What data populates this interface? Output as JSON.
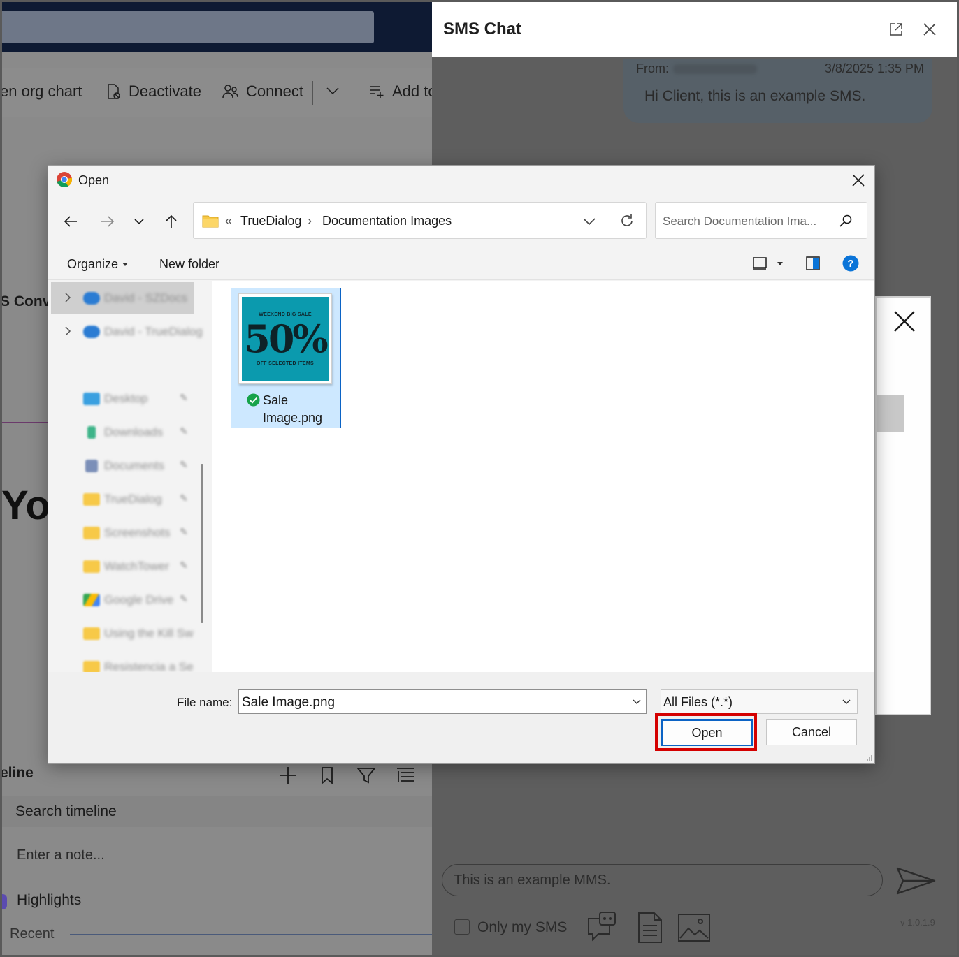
{
  "background_app": {
    "commands": {
      "org_chart": "en org chart",
      "deactivate": "Deactivate",
      "connect": "Connect",
      "add_to": "Add to"
    },
    "conversations_fragment": "S Conv",
    "heading_fragment": "Yo",
    "timeline": {
      "header": "eline",
      "search_placeholder": "Search timeline",
      "note_placeholder": "Enter a note...",
      "highlights": "Highlights",
      "recent": "Recent"
    }
  },
  "sms_chat": {
    "title": "SMS Chat",
    "message": {
      "from_label": "From:",
      "date": "3/8/2025 1:35 PM",
      "text": "Hi Client, this is an example SMS."
    },
    "compose_text": "This is an example MMS.",
    "only_my_sms_label": "Only my SMS",
    "version": "v 1.0.1.9"
  },
  "open_dialog": {
    "title": "Open",
    "breadcrumb": {
      "overflow": "«",
      "segments": [
        "TrueDialog",
        "Documentation Images"
      ],
      "separator": "›"
    },
    "search_placeholder": "Search Documentation Ima...",
    "toolbar": {
      "organize": "Organize",
      "new_folder": "New folder"
    },
    "sidebar": {
      "cloud_items": [
        "David - SZDocs",
        "David - TrueDialog"
      ],
      "quick_access": [
        "Desktop",
        "Downloads",
        "Documents",
        "TrueDialog",
        "Screenshots",
        "WatchTower",
        "Google Drive",
        "Using the Kill Sw",
        "Resistencia a Se"
      ]
    },
    "files": [
      {
        "name": "Sale Image.png",
        "name_line1": "Sale",
        "name_line2": "Image.png",
        "thumbnail": {
          "top_text": "WEEKEND BIG SALE",
          "big_text": "50%",
          "bottom_text": "OFF SELECTED ITEMS"
        },
        "status_icon": "synced-check-icon"
      }
    ],
    "file_name_label": "File name:",
    "file_name_value": "Sale Image.png",
    "file_type": "All Files (*.*)",
    "open_button": "Open",
    "cancel_button": "Cancel"
  },
  "colors": {
    "highlight": "#d40000",
    "selection": "#cde8ff",
    "accent": "#0b63c5",
    "thumbnail_bg": "#0b9aae",
    "help": "#0a74d8"
  }
}
